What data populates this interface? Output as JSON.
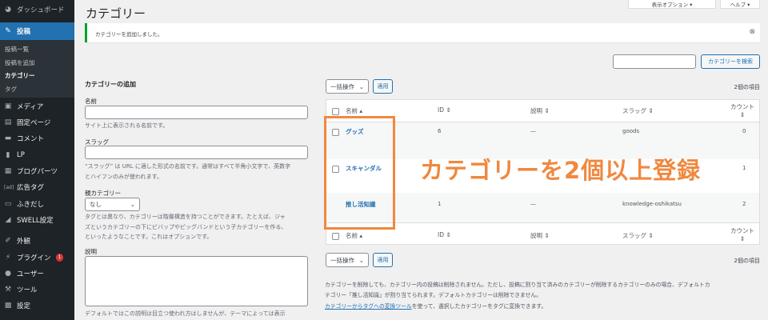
{
  "sidebar": {
    "items": [
      {
        "label": "ダッシュボード",
        "icon": "dashboard-icon"
      },
      {
        "label": "投稿",
        "icon": "pin-icon",
        "active": true
      },
      {
        "label": "メディア",
        "icon": "media-icon"
      },
      {
        "label": "固定ページ",
        "icon": "page-icon"
      },
      {
        "label": "コメント",
        "icon": "comment-icon"
      },
      {
        "label": "LP",
        "icon": "document-icon"
      },
      {
        "label": "ブログパーツ",
        "icon": "blog-parts-icon"
      },
      {
        "label": "広告タグ",
        "icon": "ad-icon",
        "icon_text": "[ad]"
      },
      {
        "label": "ふきだし",
        "icon": "speech-bubble-icon"
      },
      {
        "label": "SWELL設定",
        "icon": "swell-icon"
      },
      {
        "label": "外観",
        "icon": "appearance-icon"
      },
      {
        "label": "プラグイン",
        "icon": "plugin-icon",
        "badge": "1"
      },
      {
        "label": "ユーザー",
        "icon": "user-icon"
      },
      {
        "label": "ツール",
        "icon": "wrench-icon"
      },
      {
        "label": "設定",
        "icon": "settings-icon"
      }
    ],
    "submenu": [
      "投稿一覧",
      "投稿を追加",
      "カテゴリー",
      "タグ"
    ]
  },
  "header": {
    "title": "カテゴリー",
    "screen_options": "表示オプション ▾",
    "help": "ヘルプ ▾"
  },
  "notice": {
    "text": "カテゴリーを追加しました。"
  },
  "search": {
    "value": "",
    "button": "カテゴリーを検索"
  },
  "form": {
    "heading": "カテゴリーの追加",
    "name_label": "名前",
    "name_help": "サイト上に表示される名前です。",
    "slug_label": "スラッグ",
    "slug_help1": "“スラッグ” は URL に適した形式の名前です。通常はすべて半角小文字で、英数字",
    "slug_help2": "とハイフンのみが使われます。",
    "parent_label": "親カテゴリー",
    "parent_value": "なし",
    "parent_help1": "タグとは異なり、カテゴリーは階層構造を持つことができます。たとえば、ジャ",
    "parent_help2": "ズというカテゴリーの下にビバップやビッグバンドという子カテゴリーを作る、",
    "parent_help3": "といったようなことです。これはオプションです。",
    "desc_label": "説明",
    "desc_help": "デフォルトではこの説明は目立つ使われ方はしませんが、テーマによっては表示"
  },
  "list": {
    "bulk": "一括操作",
    "apply": "適用",
    "count": "2個の項目",
    "columns": {
      "name": "名前",
      "id": "ID",
      "desc": "説明",
      "slug": "スラッグ",
      "count": "カウント"
    },
    "rows": [
      {
        "name": "グッズ",
        "id": "6",
        "desc": "—",
        "slug": "goods",
        "count": "0"
      },
      {
        "name": "スキャンダル",
        "id": "",
        "desc": "",
        "slug": "",
        "count": "1"
      },
      {
        "name": "推し活知識",
        "id": "1",
        "desc": "—",
        "slug": "knowledge-oshikatsu",
        "count": "2"
      }
    ]
  },
  "notes": {
    "line1": "カテゴリーを削除しても、カテゴリー内の投稿は削除されません。ただし、投稿に割り当て済みのカテゴリーが削除するカテゴリーのみの場合、デフォルトカ",
    "line2": "テゴリー「推し活知識」が割り当てられます。デフォルトカテゴリーは削除できません。",
    "link": "カテゴリーからタグへの変換ツール",
    "line3": "を使って、選択したカテゴリーをタグに変換できます。"
  },
  "overlay": {
    "text": "カテゴリーを2個以上登録",
    "color": "#f0883e"
  }
}
